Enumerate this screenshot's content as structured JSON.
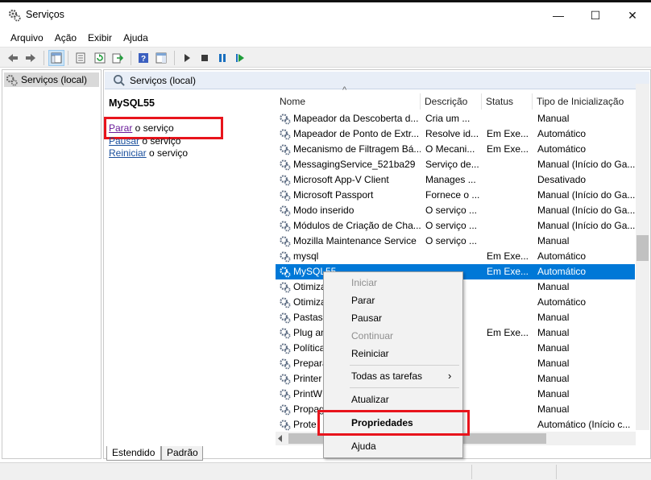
{
  "window": {
    "title": "Serviços",
    "minimize_glyph": "—",
    "maximize_glyph": "☐",
    "close_glyph": "✕"
  },
  "menubar": [
    "Arquivo",
    "Ação",
    "Exibir",
    "Ajuda"
  ],
  "toolbar": {
    "icons": [
      "back-icon",
      "forward-icon",
      "show-tree-icon",
      "properties-icon",
      "refresh-icon",
      "export-icon",
      "help-icon",
      "action-pane-icon",
      "start-icon",
      "stop-icon",
      "pause-icon",
      "restart-icon"
    ]
  },
  "tree": {
    "item_label": "Serviços (local)"
  },
  "right_header": {
    "title": "Serviços (local)"
  },
  "detail": {
    "service_name": "MySQL55",
    "stop_link": "Parar",
    "stop_rest": " o serviço",
    "pause_link": "Pausar",
    "pause_rest": " o serviço",
    "restart_link": "Reiniciar",
    "restart_rest": " o serviço"
  },
  "list": {
    "sort_indicator": "^",
    "columns": [
      "Nome",
      "Descrição",
      "Status",
      "Tipo de Inicialização"
    ],
    "rows": [
      {
        "name": "Mapeador da Descoberta d...",
        "desc": "Cria um ...",
        "status": "",
        "startup": "Manual"
      },
      {
        "name": "Mapeador de Ponto de Extr...",
        "desc": "Resolve id...",
        "status": "Em Exe...",
        "startup": "Automático"
      },
      {
        "name": "Mecanismo de Filtragem Bá...",
        "desc": "O Mecani...",
        "status": "Em Exe...",
        "startup": "Automático"
      },
      {
        "name": "MessagingService_521ba29",
        "desc": "Serviço de...",
        "status": "",
        "startup": "Manual (Início do Ga..."
      },
      {
        "name": "Microsoft App-V Client",
        "desc": "Manages ...",
        "status": "",
        "startup": "Desativado"
      },
      {
        "name": "Microsoft Passport",
        "desc": "Fornece o ...",
        "status": "",
        "startup": "Manual (Início do Ga..."
      },
      {
        "name": "Modo inserido",
        "desc": "O serviço ...",
        "status": "",
        "startup": "Manual (Início do Ga..."
      },
      {
        "name": "Módulos de Criação de Cha...",
        "desc": "O serviço ...",
        "status": "",
        "startup": "Manual (Início do Ga..."
      },
      {
        "name": "Mozilla Maintenance Service",
        "desc": "O serviço ...",
        "status": "",
        "startup": "Manual"
      },
      {
        "name": "mysql",
        "desc": "",
        "status": "Em Exe...",
        "startup": "Automático"
      },
      {
        "name": "MySQL55",
        "desc": "",
        "status": "Em Exe...",
        "startup": "Automático"
      },
      {
        "name": "Otimiza",
        "desc": "",
        "status": "",
        "startup": "Manual"
      },
      {
        "name": "Otimiza",
        "desc": "",
        "status": "",
        "startup": "Automático"
      },
      {
        "name": "Pastas",
        "desc": "",
        "status": "",
        "startup": "Manual"
      },
      {
        "name": "Plug an",
        "desc": "",
        "status": "Em Exe...",
        "startup": "Manual"
      },
      {
        "name": "Política",
        "desc": "",
        "status": "",
        "startup": "Manual"
      },
      {
        "name": "Prepara",
        "desc": "",
        "status": "",
        "startup": "Manual"
      },
      {
        "name": "Printer",
        "desc": "",
        "status": "",
        "startup": "Manual"
      },
      {
        "name": "PrintW",
        "desc": "",
        "status": "",
        "startup": "Manual"
      },
      {
        "name": "Propag",
        "desc": "",
        "status": "",
        "startup": "Manual"
      },
      {
        "name": "Prote",
        "desc": "",
        "status": "",
        "startup": "Automático (Início c..."
      }
    ]
  },
  "tabs": [
    "Estendido",
    "Padrão"
  ],
  "context_menu": {
    "items": [
      {
        "label": "Iniciar",
        "disabled": true
      },
      {
        "label": "Parar",
        "disabled": false
      },
      {
        "label": "Pausar",
        "disabled": false
      },
      {
        "label": "Continuar",
        "disabled": true
      },
      {
        "label": "Reiniciar",
        "disabled": false
      },
      {
        "label": "Todas as tarefas",
        "disabled": false,
        "submenu": true
      },
      {
        "label": "Atualizar",
        "disabled": false
      },
      {
        "label": "Propriedades",
        "disabled": false,
        "bold": true
      },
      {
        "label": "Ajuda",
        "disabled": false
      }
    ],
    "submenu_arrow": "›"
  },
  "colors": {
    "selection": "#0078d7",
    "highlight_box": "#e8141c",
    "header_band": "#e8eef7"
  }
}
